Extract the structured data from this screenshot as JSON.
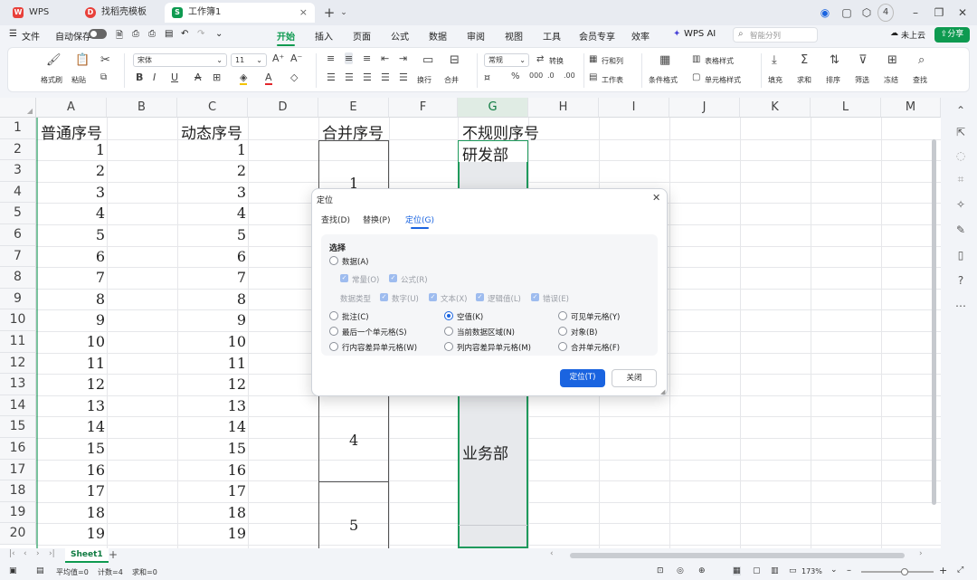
{
  "titlebar": {
    "tabs": [
      {
        "label": "WPS Office"
      },
      {
        "label": "找稻壳模板"
      },
      {
        "label": "工作簿1"
      }
    ],
    "new_tab": "+",
    "badge": "4"
  },
  "menubar": {
    "file": "文件",
    "autosave": "自动保存",
    "items": [
      "开始",
      "插入",
      "页面",
      "公式",
      "数据",
      "审阅",
      "视图",
      "工具",
      "会员专享",
      "效率",
      "WPS AI"
    ],
    "active": "开始",
    "search_placeholder": "智能分列",
    "cloud": "未上云",
    "share": "分享"
  },
  "ribbon": {
    "format_brush": "格式刷",
    "paste": "粘贴",
    "font_name": "宋体",
    "font_size": "11",
    "wrap": "换行",
    "merge": "合并",
    "number_format": "常规",
    "convert": "转换",
    "row_col": "行和列",
    "worksheet": "工作表",
    "cond_format": "条件格式",
    "table_style": "表格样式",
    "cell_style": "单元格样式",
    "fill": "填充",
    "sum": "求和",
    "sort": "排序",
    "filter": "筛选",
    "freeze": "冻结",
    "find": "查找"
  },
  "sheet": {
    "columns": [
      "A",
      "B",
      "C",
      "D",
      "E",
      "F",
      "G",
      "H",
      "I",
      "J",
      "K",
      "L",
      "M"
    ],
    "rows": [
      "1",
      "2",
      "3",
      "4",
      "5",
      "6",
      "7",
      "8",
      "9",
      "10",
      "11",
      "12",
      "13",
      "14",
      "15",
      "16",
      "17",
      "18",
      "19",
      "20"
    ],
    "headers": {
      "A": "普通序号",
      "C": "动态序号",
      "E": "合并序号",
      "G": "不规则序号"
    },
    "colA": [
      "1",
      "2",
      "3",
      "4",
      "5",
      "6",
      "7",
      "8",
      "9",
      "10",
      "11",
      "12",
      "13",
      "14",
      "15",
      "16",
      "17",
      "18",
      "19"
    ],
    "colC": [
      "1",
      "2",
      "3",
      "4",
      "5",
      "6",
      "7",
      "8",
      "9",
      "10",
      "11",
      "12",
      "13",
      "14",
      "15",
      "16",
      "17",
      "18",
      "19"
    ],
    "merged_E": [
      "1",
      "4",
      "5"
    ],
    "colG": {
      "dept1": "研发部",
      "dept2": "业务部"
    }
  },
  "sheettabs": {
    "active": "Sheet1",
    "add": "+"
  },
  "statusbar": {
    "average": "平均值=0",
    "count": "计数=4",
    "sum": "求和=0",
    "zoom": "173%"
  },
  "dialog": {
    "title": "定位",
    "tabs": [
      "查找(D)",
      "替换(P)",
      "定位(G)"
    ],
    "active_tab": "定位(G)",
    "section": "选择",
    "data_option": "数据(A)",
    "constant": "常量(O)",
    "formula": "公式(R)",
    "data_type_label": "数据类型",
    "number": "数字(U)",
    "text": "文本(X)",
    "logical": "逻辑值(L)",
    "error": "错误(E)",
    "options": [
      "批注(C)",
      "空值(K)",
      "可见单元格(Y)",
      "最后一个单元格(S)",
      "当前数据区域(N)",
      "对象(B)",
      "行内容差异单元格(W)",
      "列内容差异单元格(M)",
      "合并单元格(F)"
    ],
    "selected": "空值(K)",
    "ok": "定位(T)",
    "close": "关闭"
  },
  "colors": {
    "accent": "#0e9a50",
    "dialog_accent": "#1a64e0",
    "wps_red": "#e8403a"
  }
}
